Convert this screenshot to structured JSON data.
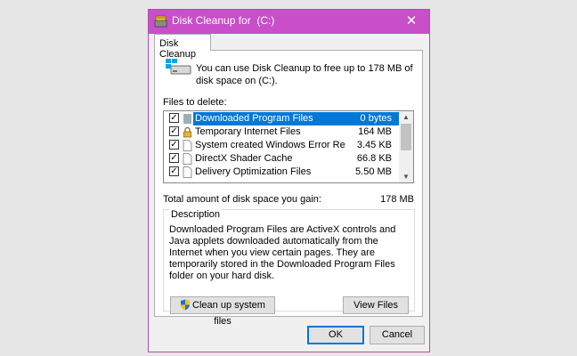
{
  "window": {
    "title": "Disk Cleanup for  (C:)",
    "close_glyph": "✕",
    "accent_color": "#c94ec9"
  },
  "tab": {
    "label": "Disk Cleanup"
  },
  "intro_text": "You can use Disk Cleanup to free up to 178 MB of disk space on  (C:).",
  "files_to_delete_label": "Files to delete:",
  "files": [
    {
      "name": "Downloaded Program Files",
      "size": "0 bytes",
      "checked": true,
      "selected": true,
      "icon": "folder-icon"
    },
    {
      "name": "Temporary Internet Files",
      "size": "164 MB",
      "checked": true,
      "selected": false,
      "icon": "lock-icon"
    },
    {
      "name": "System created Windows Error Reporti...",
      "size": "3.45 KB",
      "checked": true,
      "selected": false,
      "icon": "file-icon"
    },
    {
      "name": "DirectX Shader Cache",
      "size": "66.8 KB",
      "checked": true,
      "selected": false,
      "icon": "file-icon"
    },
    {
      "name": "Delivery Optimization Files",
      "size": "5.50 MB",
      "checked": true,
      "selected": false,
      "icon": "file-icon"
    }
  ],
  "total": {
    "label": "Total amount of disk space you gain:",
    "value": "178 MB"
  },
  "description": {
    "legend": "Description",
    "text": "Downloaded Program Files are ActiveX controls and Java applets downloaded automatically from the Internet when you view certain pages. They are temporarily stored in the Downloaded Program Files folder on your hard disk."
  },
  "buttons": {
    "cleanup": "Clean up system files",
    "view_files": "View Files",
    "ok": "OK",
    "cancel": "Cancel"
  }
}
